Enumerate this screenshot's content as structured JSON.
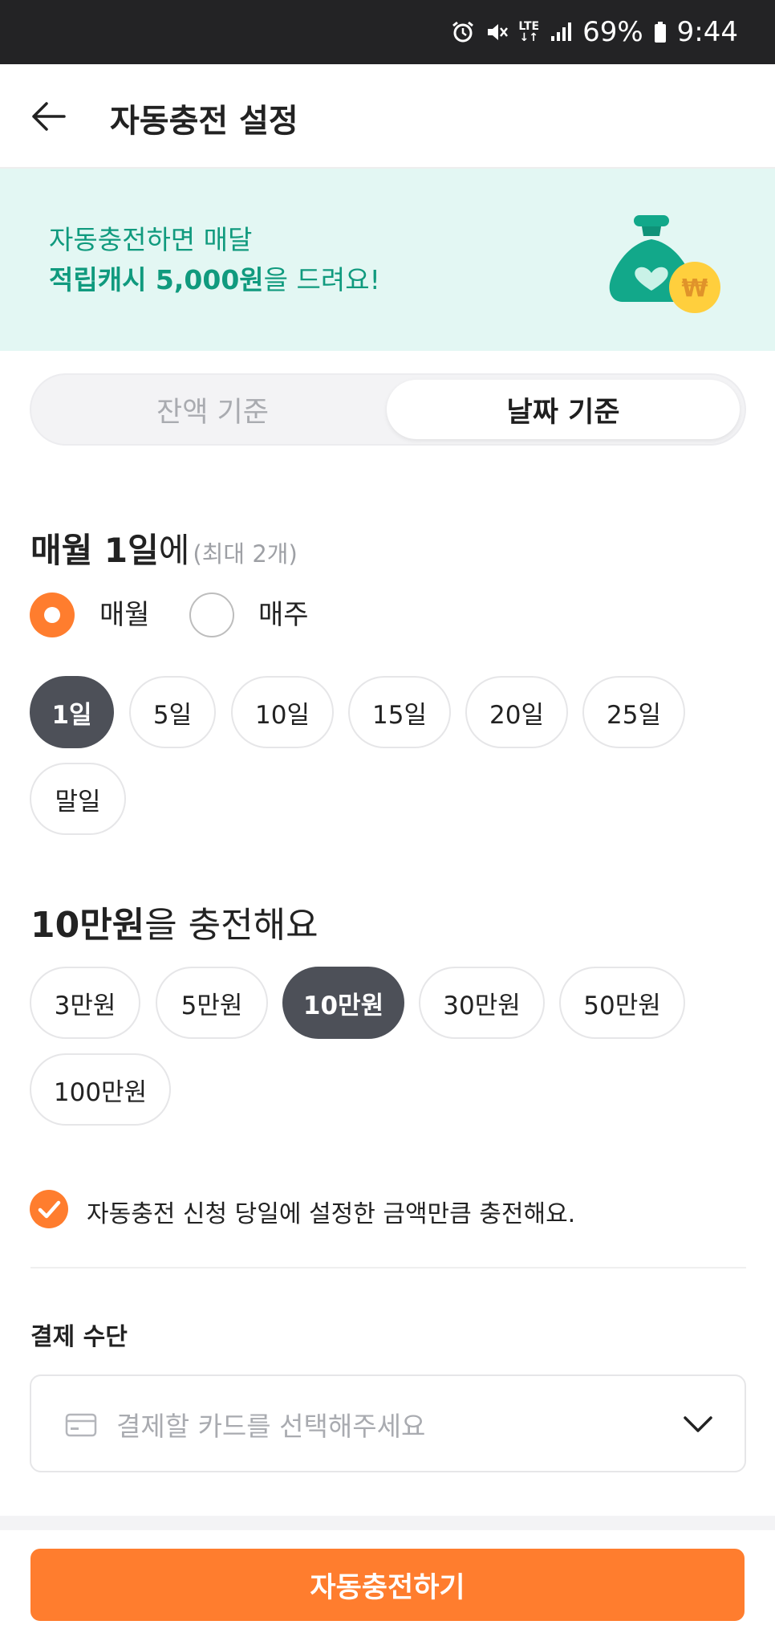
{
  "status_bar": {
    "lte": "LTE",
    "battery": "69%",
    "time": "9:44"
  },
  "header": {
    "title": "자동충전 설정"
  },
  "banner": {
    "line1": "자동충전하면 매달",
    "line2_bold": "적립캐시 5,000원",
    "line2_rest": "을 드려요!",
    "coin_symbol": "₩"
  },
  "segment": {
    "left_label": "잔액 기준",
    "right_label": "날짜 기준",
    "selected": "날짜 기준"
  },
  "schedule": {
    "title_bold": "매월 1일",
    "title_rest": "에",
    "title_note": "(최대 2개)",
    "radios": [
      {
        "label": "매월",
        "checked": true
      },
      {
        "label": "매주",
        "checked": false
      }
    ],
    "days": [
      "1일",
      "5일",
      "10일",
      "15일",
      "20일",
      "25일",
      "말일"
    ],
    "selected_day": "1일"
  },
  "amount": {
    "title_bold": "10만원",
    "title_rest": "을 충전해요",
    "options": [
      "3만원",
      "5만원",
      "10만원",
      "30만원",
      "50만원",
      "100만원"
    ],
    "selected": "10만원"
  },
  "agreement": {
    "label": "자동충전 신청 당일에 설정한 금액만큼 충전해요.",
    "checked": true
  },
  "payment": {
    "title": "결제 수단",
    "placeholder": "결제할 카드를 선택해주세요"
  },
  "cta": {
    "label": "자동충전하기"
  },
  "colors": {
    "accent": "#ff7d2e",
    "banner_bg": "#e3f7f3",
    "banner_text": "#109a7e",
    "chip_selected": "#4d5058"
  }
}
